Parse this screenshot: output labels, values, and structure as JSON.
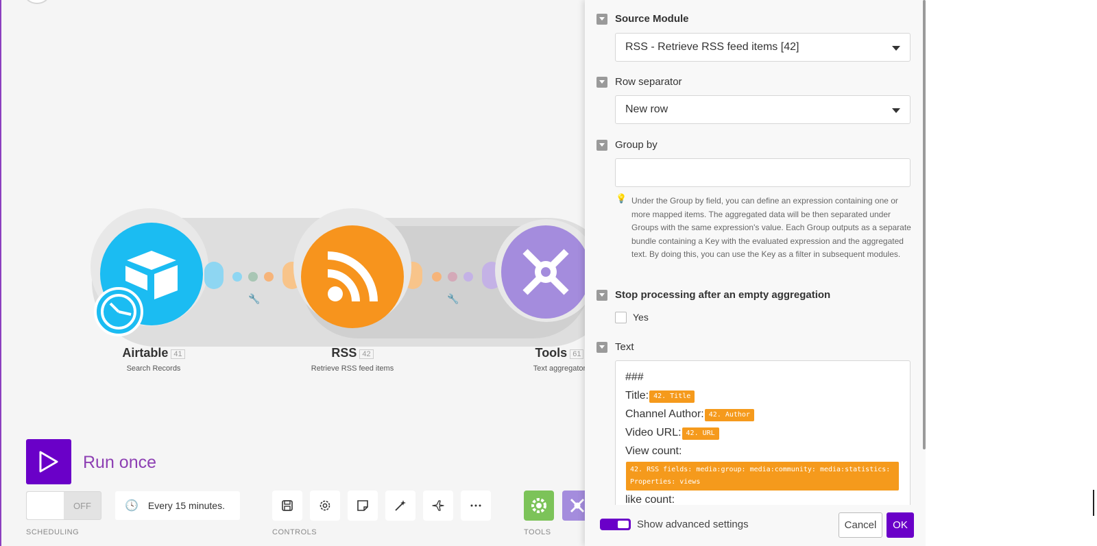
{
  "modules": [
    {
      "name": "Airtable",
      "id": "41",
      "description": "Search Records",
      "icon": "airtable-box-icon",
      "color": "#1bbcf2"
    },
    {
      "name": "RSS",
      "id": "42",
      "description": "Retrieve RSS feed items",
      "icon": "rss-icon",
      "color": "#f7941d"
    },
    {
      "name": "Tools",
      "id": "61",
      "description": "Text aggregator",
      "icon": "tools-icon",
      "color": "#a48cdd"
    }
  ],
  "toolbar": {
    "run_once_label": "Run once",
    "schedule_toggle": "OFF",
    "schedule_interval": "Every 15 minutes.",
    "captions": {
      "scheduling": "SCHEDULING",
      "controls": "CONTROLS",
      "tools": "TOOLS"
    }
  },
  "panel": {
    "source_module": {
      "label": "Source Module",
      "value": "RSS - Retrieve RSS feed items [42]"
    },
    "row_separator": {
      "label": "Row separator",
      "value": "New row"
    },
    "group_by": {
      "label": "Group by",
      "value": "",
      "hint": "Under the Group by field, you can define an expression containing one or more mapped items. The aggregated data will be then separated under Groups with the same expression's value. Each Group outputs as a separate bundle containing a Key with the evaluated expression and the aggregated text. By doing this, you can use the Key as a filter in subsequent modules."
    },
    "stop_processing": {
      "label": "Stop processing after an empty aggregation",
      "option": "Yes",
      "checked": false
    },
    "text": {
      "label": "Text",
      "line1": "###",
      "title_label": "Title:",
      "title_pill": "42. Title",
      "author_label": "Channel Author:",
      "author_pill": "42. Author",
      "url_label": "Video URL:",
      "url_pill": "42. URL",
      "views_label": "View count:",
      "views_pill": "42. RSS fields: media:group: media:community: media:statistics: Properties: views",
      "like_label": "like count:"
    },
    "footer": {
      "advanced_label": "Show advanced settings",
      "advanced_on": true,
      "cancel_label": "Cancel",
      "ok_label": "OK"
    }
  },
  "colors": {
    "accent": "#6a00c8",
    "pill": "#f59a1c",
    "run_text": "#8d3fb3"
  }
}
